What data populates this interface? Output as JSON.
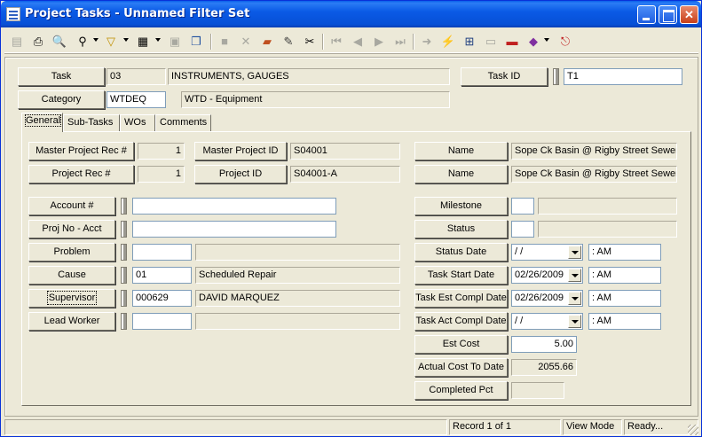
{
  "window": {
    "title": "Project Tasks - Unnamed Filter Set"
  },
  "header": {
    "task_label": "Task",
    "task_code": "03",
    "task_desc": "INSTRUMENTS, GAUGES",
    "category_label": "Category",
    "category_code": "WTDEQ",
    "category_desc": "WTD - Equipment",
    "taskid_label": "Task ID",
    "taskid_value": "T1"
  },
  "tabs": [
    {
      "label": "General"
    },
    {
      "label": "Sub-Tasks"
    },
    {
      "label": "WOs"
    },
    {
      "label": "Comments"
    }
  ],
  "general": {
    "master_project_rec_label": "Master Project Rec #",
    "master_project_rec": "1",
    "master_project_id_label": "Master Project ID",
    "master_project_id": "S04001",
    "project_rec_label": "Project Rec #",
    "project_rec": "1",
    "project_id_label": "Project ID",
    "project_id": "S04001-A",
    "name1_label": "Name",
    "name1": "Sope Ck Basin @ Rigby Street Sewer",
    "name2_label": "Name",
    "name2": "Sope Ck Basin @ Rigby Street Sewer",
    "account_label": "Account #",
    "account": "",
    "projno_label": "Proj No - Acct",
    "projno": "",
    "problem_label": "Problem",
    "problem_code": "",
    "problem_desc": "",
    "cause_label": "Cause",
    "cause_code": "01",
    "cause_desc": "Scheduled Repair",
    "supervisor_label": "Supervisor",
    "supervisor_code": "000629",
    "supervisor_desc": "DAVID MARQUEZ",
    "leadworker_label": "Lead Worker",
    "leadworker_code": "",
    "leadworker_desc": "",
    "milestone_label": "Milestone",
    "milestone": "",
    "milestone_desc": "",
    "status_label": "Status",
    "status": "",
    "status_desc": "",
    "status_date_label": "Status Date",
    "status_date": " / /",
    "status_time": " :  AM",
    "task_start_label": "Task Start Date",
    "task_start_date": "02/26/2009",
    "task_start_time": " :  AM",
    "task_est_label": "Task Est Compl Date",
    "task_est_date": "02/26/2009",
    "task_est_time": " :  AM",
    "task_act_label": "Task Act Compl Date",
    "task_act_date": " / /",
    "task_act_time": " :  AM",
    "est_cost_label": "Est Cost",
    "est_cost": "5.00",
    "actual_cost_label": "Actual Cost To Date",
    "actual_cost": "2055.66",
    "completed_label": "Completed Pct",
    "completed": ""
  },
  "status": {
    "record": "Record 1 of 1",
    "mode": "View Mode",
    "state": "Ready..."
  }
}
